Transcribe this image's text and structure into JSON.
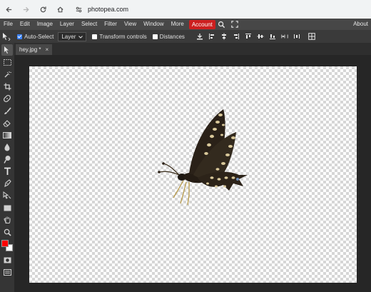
{
  "browser": {
    "url": "photopea.com",
    "back_icon": "arrow-left-icon",
    "forward_icon": "arrow-right-icon",
    "reload_icon": "reload-icon",
    "home_icon": "home-icon",
    "site_info_icon": "site-settings-icon"
  },
  "menu": {
    "items": [
      "File",
      "Edit",
      "Image",
      "Layer",
      "Select",
      "Filter",
      "View",
      "Window",
      "More"
    ],
    "account_label": "Account",
    "account_color": "#cc1f1f",
    "search_icon": "search-icon",
    "fullscreen_icon": "fullscreen-icon",
    "about_label": "About"
  },
  "options": {
    "auto_select_label": "Auto-Select",
    "auto_select_checked": true,
    "layer_select_value": "Layer",
    "transform_controls_label": "Transform controls",
    "transform_controls_checked": false,
    "distances_label": "Distances",
    "distances_checked": false
  },
  "tools": [
    "move-tool-icon",
    "marquee-select-icon",
    "magic-wand-icon",
    "crop-icon",
    "spot-healing-icon",
    "brush-icon",
    "eraser-icon",
    "gradient-icon",
    "blur-icon",
    "dodge-icon",
    "text-tool-icon",
    "pen-tool-icon",
    "path-select-icon",
    "rectangle-shape-icon",
    "hand-tool-icon",
    "zoom-tool-icon"
  ],
  "colors": {
    "foreground": "#ff0000",
    "background": "#ffffff"
  },
  "document": {
    "tab_title": "hey.jpg *",
    "close_glyph": "×"
  }
}
